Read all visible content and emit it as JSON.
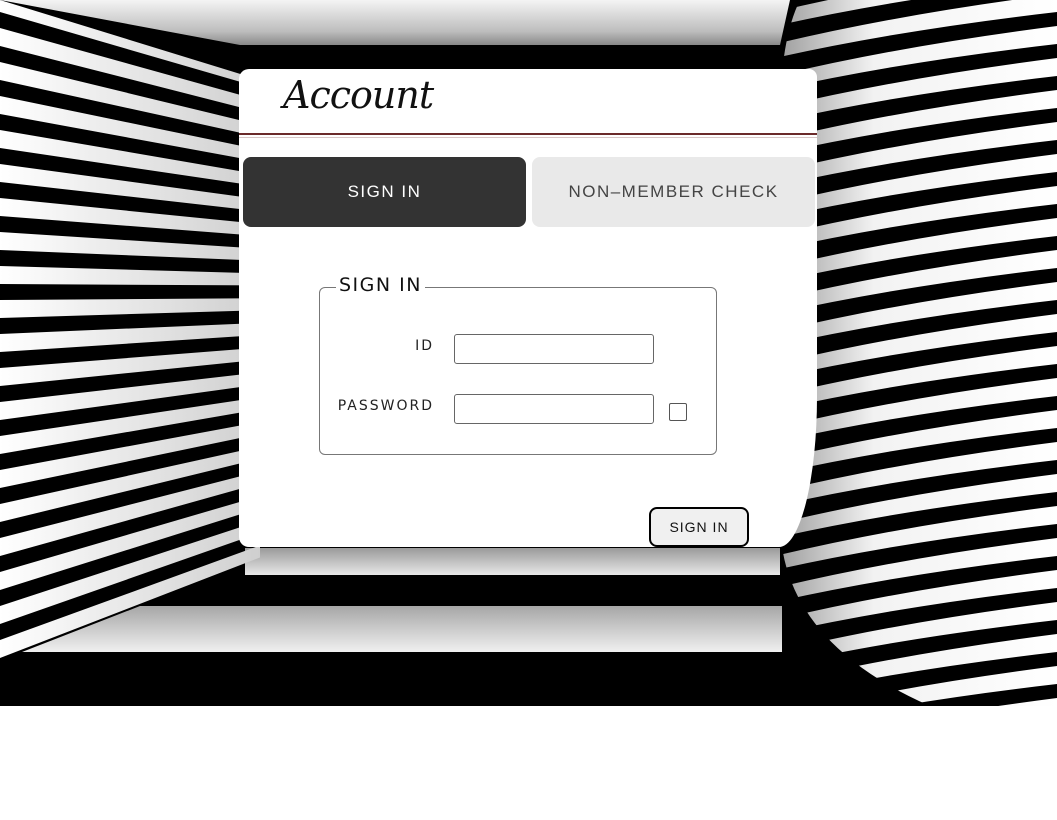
{
  "header": {
    "title": "Account"
  },
  "tabs": [
    {
      "label": "SIGN IN",
      "active": true
    },
    {
      "label": "NON–MEMBER CHECK",
      "active": false
    }
  ],
  "form": {
    "legend": "SIGN IN",
    "id_label": "ID",
    "id_value": "",
    "password_label": "PASSWORD",
    "password_value": "",
    "remember_checked": false
  },
  "submit_label": "SIGN IN",
  "colors": {
    "active_tab": "#333333",
    "inactive_tab": "#e9e9e9",
    "header_rule": "#6b2a2a",
    "background_stripes": "#000000"
  },
  "background_icon": "black-and-white-striped-room"
}
